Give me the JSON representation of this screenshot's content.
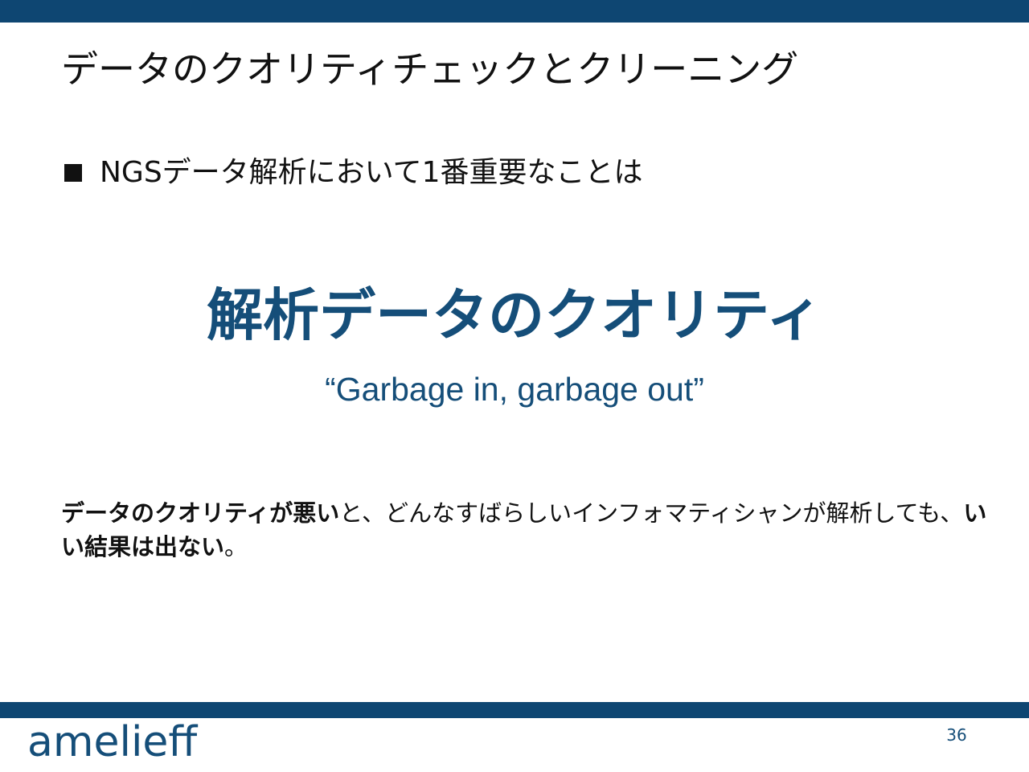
{
  "colors": {
    "brand_navy": "#0e4672",
    "accent_blue": "#154e79",
    "text": "#111111",
    "background": "#ffffff"
  },
  "slide": {
    "title": "データのクオリティチェックとクリーニング",
    "bullet": "NGSデータ解析において1番重要なことは",
    "headline": "解析データのクオリティ",
    "quote": "“Garbage in, garbage out”",
    "note": {
      "part1_bold": "データのクオリティが悪い",
      "part2": "と、どんなすばらしいインフォマティシャンが解析しても、",
      "part3_bold": "いい結果は出ない",
      "part4": "。"
    }
  },
  "footer": {
    "logo_text": "amelieff",
    "page_number": "36"
  }
}
